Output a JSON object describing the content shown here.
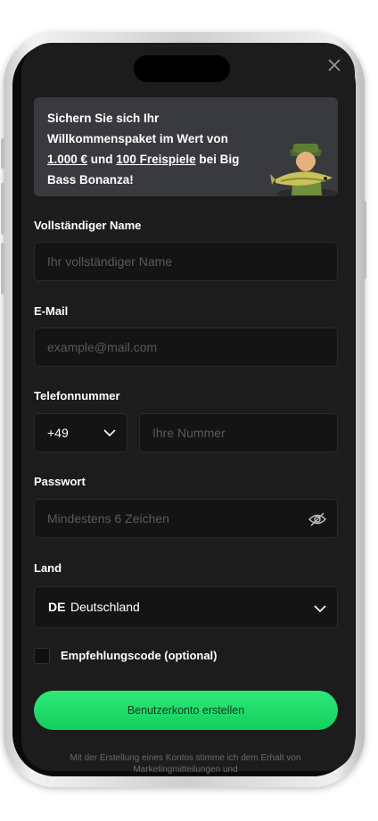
{
  "banner": {
    "line1": "Sichern Sie sich Ihr",
    "line2": "Willkommenspaket im Wert von",
    "amount": "1.000 €",
    "and": " und ",
    "spins": "100 Freispiele",
    "line3_tail": " bei Big",
    "line4": "Bass Bonanza!"
  },
  "close_icon": "close-icon",
  "form": {
    "name_label": "Vollständiger Name",
    "name_placeholder": "Ihr vollständiger Name",
    "email_label": "E-Mail",
    "email_placeholder": "example@mail.com",
    "phone_label": "Telefonnummer",
    "phone_prefix": "+49",
    "phone_placeholder": "Ihre Nummer",
    "password_label": "Passwort",
    "password_placeholder": "Mindestens 6 Zeichen",
    "country_label": "Land",
    "country_code": "DE",
    "country_name": "Deutschland",
    "referral_label": "Empfehlungscode (optional)",
    "submit_label": "Benutzerkonto erstellen",
    "disclaimer": "Mit der Erstellung eines Kontos stimme ich dem Erhalt von Marketingmitteilungen und"
  },
  "colors": {
    "accent": "#1fdc69",
    "screen_bg": "#1c1c1c",
    "field_bg": "#141414",
    "banner_bg": "#393a3d"
  }
}
